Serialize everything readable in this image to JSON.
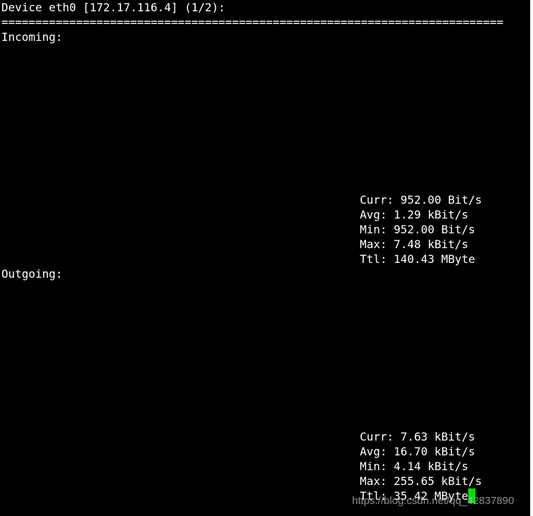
{
  "header": {
    "title": "Device eth0 [172.17.116.4] (1/2):",
    "separator": "=========================================================================="
  },
  "incoming": {
    "label": "Incoming:",
    "stats": [
      "Curr: 952.00 Bit/s",
      "Avg: 1.29 kBit/s",
      "Min: 952.00 Bit/s",
      "Max: 7.48 kBit/s",
      "Ttl: 140.43 MByte"
    ]
  },
  "outgoing": {
    "label": "Outgoing:",
    "stats": [
      "Curr: 7.63 kBit/s",
      "Avg: 16.70 kBit/s",
      "Min: 4.14 kBit/s",
      "Max: 255.65 kBit/s",
      "Ttl: 35.42 MByte"
    ]
  },
  "watermark": "https://blog.csdn.net/qq_42837890",
  "colors": {
    "background": "#000000",
    "text": "#ffffff",
    "cursor": "#00e000"
  }
}
